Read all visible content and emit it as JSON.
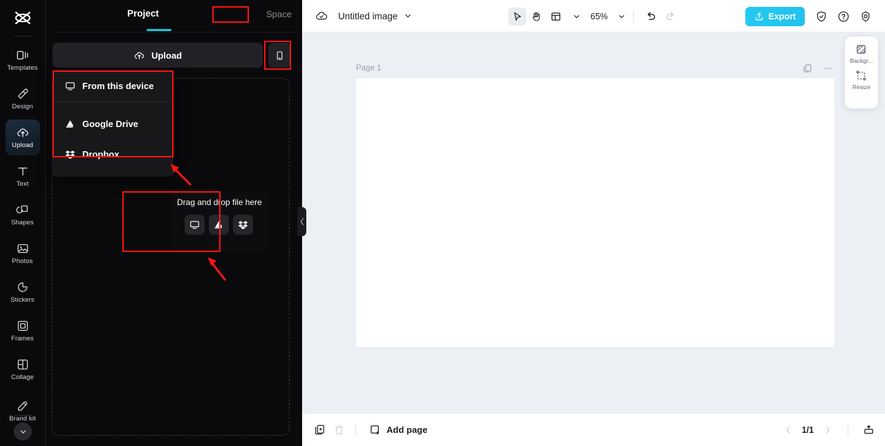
{
  "rail": {
    "logo_icon": "capcut-logo-icon",
    "items": [
      {
        "label": "Templates",
        "icon": "templates-icon",
        "active": false
      },
      {
        "label": "Design",
        "icon": "design-icon",
        "active": false
      },
      {
        "label": "Upload",
        "icon": "upload-cloud-icon",
        "active": true
      },
      {
        "label": "Text",
        "icon": "text-icon",
        "active": false
      },
      {
        "label": "Shapes",
        "icon": "shapes-icon",
        "active": false
      },
      {
        "label": "Photos",
        "icon": "photos-icon",
        "active": false
      },
      {
        "label": "Stickers",
        "icon": "stickers-icon",
        "active": false
      },
      {
        "label": "Frames",
        "icon": "frames-icon",
        "active": false
      },
      {
        "label": "Collage",
        "icon": "collage-icon",
        "active": false
      },
      {
        "label": "Brand kit",
        "icon": "brand-kit-icon",
        "active": false
      }
    ],
    "expand_icon": "chevron-down-icon"
  },
  "panel": {
    "tab_project": "Project",
    "tab_space": "Space",
    "upload_button": "Upload",
    "upload_icon": "upload-cloud-icon",
    "mobile_button_icon": "mobile-phone-icon",
    "menu": [
      {
        "label": "From this device",
        "icon": "monitor-icon"
      },
      {
        "label": "Google Drive",
        "icon": "google-drive-icon"
      },
      {
        "label": "Dropbox",
        "icon": "dropbox-icon"
      }
    ],
    "dragbox": {
      "title": "Drag and drop file here",
      "icons": [
        "monitor-icon",
        "google-drive-icon",
        "dropbox-icon"
      ]
    },
    "collapse_icon": "chevron-left-icon"
  },
  "editor": {
    "topbar": {
      "cloud_icon": "cloud-saved-icon",
      "doc_title": "Untitled image",
      "title_caret_icon": "chevron-down-icon",
      "select_tool_icon": "cursor-select-icon",
      "hand_tool_icon": "hand-pan-icon",
      "layout_tool_icon": "layout-grid-icon",
      "layout_caret_icon": "chevron-down-icon",
      "zoom_level": "65%",
      "zoom_caret_icon": "chevron-down-icon",
      "undo_icon": "undo-icon",
      "redo_icon": "redo-icon",
      "export_label": "Export",
      "export_icon": "export-upload-icon",
      "shield_icon": "shield-check-icon",
      "help_icon": "question-circle-icon",
      "settings_icon": "gear-icon"
    },
    "canvas": {
      "page_label": "Page 1",
      "duplicate_icon": "duplicate-page-icon",
      "more_icon": "more-horizontal-icon"
    },
    "float_panel": [
      {
        "label": "Backgr...",
        "icon": "background-icon"
      },
      {
        "label": "Resize",
        "icon": "resize-icon"
      }
    ],
    "bottombar": {
      "duplicate_icon": "duplicate-page-icon",
      "delete_icon": "trash-icon",
      "add_page_icon": "add-page-icon",
      "add_page_label": "Add page",
      "prev_icon": "chevron-left-icon",
      "page_indicator": "1/1",
      "next_icon": "chevron-right-icon",
      "present_icon": "present-icon"
    }
  },
  "annotations": {
    "accent_red": "#f81414",
    "boxes": [
      "space-tab",
      "mobile-upload-button",
      "upload-source-menu",
      "drag-and-drop-box"
    ],
    "arrows": [
      "arrow-to-upload-source-menu",
      "arrow-to-drag-and-drop-box"
    ]
  },
  "colors": {
    "brand_cyan": "#14c8de",
    "export_cyan": "#23c6ef",
    "panel_bg": "#0a0a0c",
    "canvas_bg": "#eceff3"
  }
}
